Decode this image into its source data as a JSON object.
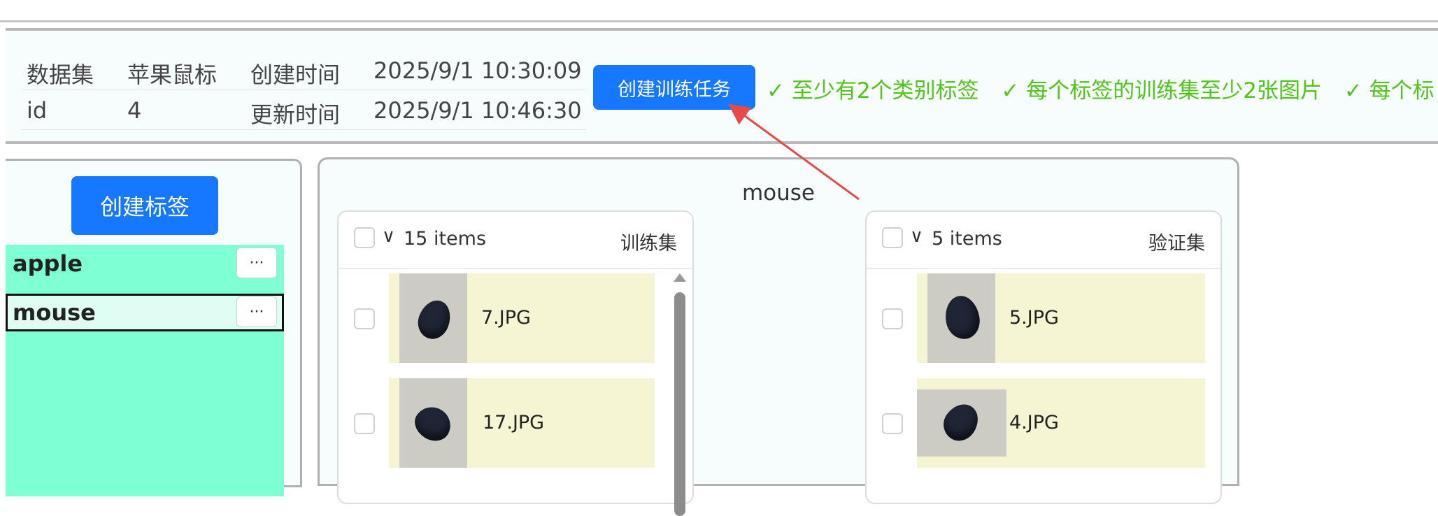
{
  "dataset_info": {
    "dataset_label": "数据集",
    "dataset_value": "苹果鼠标",
    "created_label": "创建时间",
    "created_value": "2025/9/1 10:30:09",
    "id_label": "id",
    "id_value": "4",
    "updated_label": "更新时间",
    "updated_value": "2025/9/1 10:46:30"
  },
  "create_task_button": "创建训练任务",
  "requirements": [
    "✓ 至少有2个类别标签",
    "✓ 每个标签的训练集至少2张图片",
    "✓ 每个标"
  ],
  "left_panel": {
    "create_label_button": "创建标签",
    "labels": [
      {
        "name": "apple",
        "more": "···"
      },
      {
        "name": "mouse",
        "more": "···"
      }
    ]
  },
  "main": {
    "title": "mouse",
    "train": {
      "count": "15 items",
      "name": "训练集",
      "items": [
        {
          "file": "7.JPG"
        },
        {
          "file": "17.JPG"
        }
      ]
    },
    "val": {
      "count": "5 items",
      "name": "验证集",
      "items": [
        {
          "file": "5.JPG"
        },
        {
          "file": "4.JPG"
        }
      ]
    }
  },
  "colors": {
    "primary": "#1677ff",
    "success": "#52c41a",
    "label_list_bg": "#7fffd4",
    "item_bg": "#f5f5d3",
    "annotation_arrow": "#e84a4a"
  },
  "icons": [
    "chevron-down-icon",
    "checkmark-icon",
    "more-icon",
    "scroll-up-icon",
    "annotation-arrow"
  ]
}
